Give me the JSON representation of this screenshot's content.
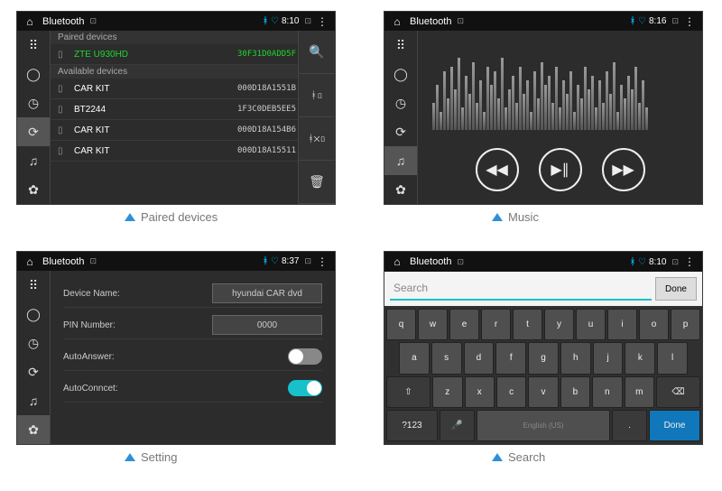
{
  "topbar": {
    "title": "Bluetooth",
    "pic": "⊡"
  },
  "times": {
    "p1": "8:10",
    "p2": "8:16",
    "p3": "8:37",
    "p4": "8:10"
  },
  "captions": {
    "p1": "Paired devices",
    "p2": "Music",
    "p3": "Setting",
    "p4": "Search"
  },
  "devices": {
    "paired_header": "Paired devices",
    "available_header": "Available devices",
    "paired": [
      {
        "name": "ZTE U930HD",
        "mac": "30F31D0ADD5F"
      }
    ],
    "available": [
      {
        "name": "CAR KIT",
        "mac": "000D18A1551B"
      },
      {
        "name": "BT2244",
        "mac": "1F3C0DEB5EE5"
      },
      {
        "name": "CAR KIT",
        "mac": "000D18A154B6"
      },
      {
        "name": "CAR KIT",
        "mac": "000D18A15511"
      }
    ]
  },
  "setting": {
    "device_name_label": "Device Name:",
    "device_name_value": "hyundai CAR dvd",
    "pin_label": "PIN Number:",
    "pin_value": "0000",
    "autoanswer_label": "AutoAnswer:",
    "autoanswer_on": false,
    "autoconnect_label": "AutoConncet:",
    "autoconnect_on": true
  },
  "search": {
    "placeholder": "Search",
    "done": "Done",
    "rows": [
      [
        "q",
        "w",
        "e",
        "r",
        "t",
        "y",
        "u",
        "i",
        "o",
        "p"
      ],
      [
        "a",
        "s",
        "d",
        "f",
        "g",
        "h",
        "j",
        "k",
        "l"
      ],
      [
        "⇧",
        "z",
        "x",
        "c",
        "v",
        "b",
        "n",
        "m",
        "⌫"
      ]
    ],
    "sym": "?123",
    "space": "English (US)",
    "done2": "Done"
  }
}
